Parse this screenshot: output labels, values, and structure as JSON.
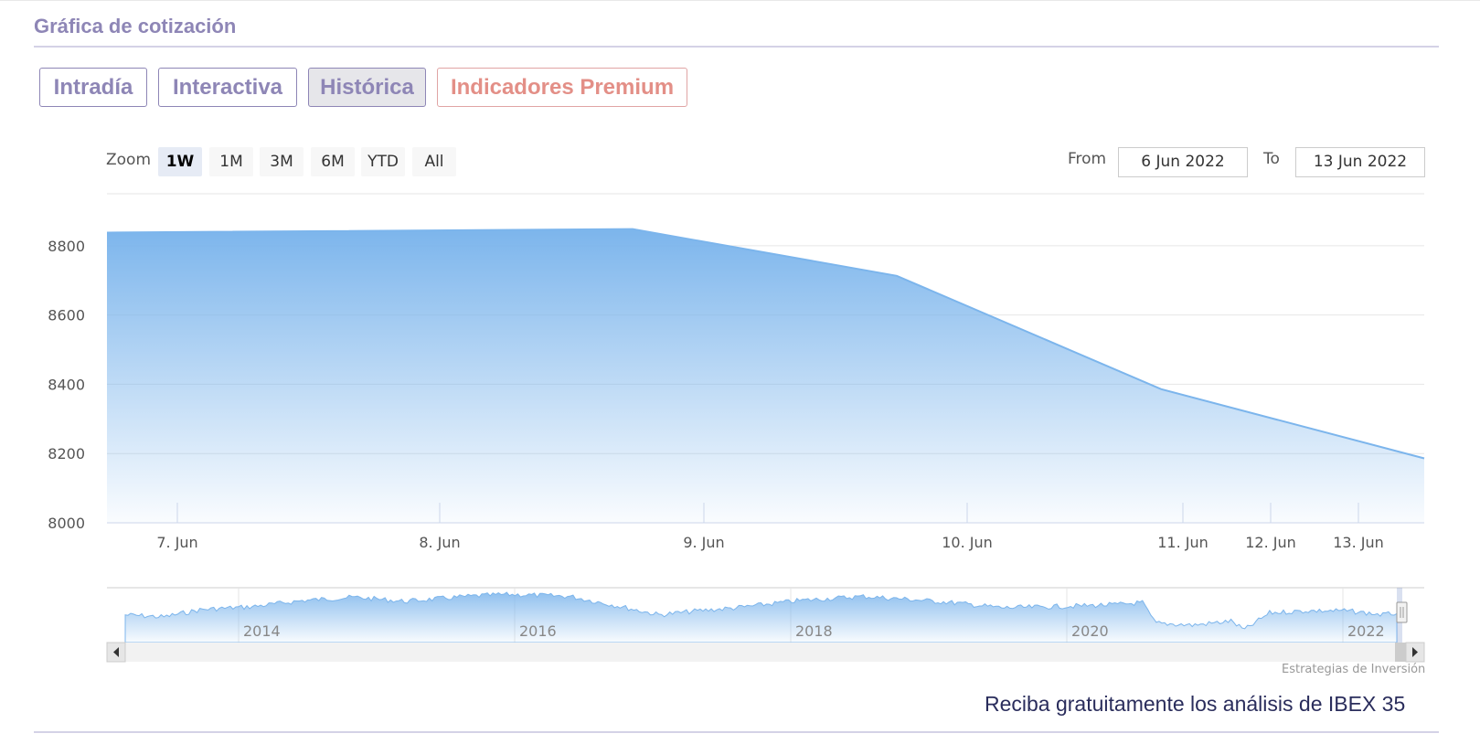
{
  "header": {
    "title": "Gráfica de cotización"
  },
  "tabs": [
    {
      "label": "Intradía"
    },
    {
      "label": "Interactiva"
    },
    {
      "label": "Histórica"
    },
    {
      "label": "Indicadores Premium"
    }
  ],
  "active_tab": "Histórica",
  "range_selector": {
    "zoom_label": "Zoom",
    "buttons": [
      "1W",
      "1M",
      "3M",
      "6M",
      "YTD",
      "All"
    ],
    "active": "1W",
    "from_label": "From",
    "from_value": "6 Jun 2022",
    "to_label": "To",
    "to_value": "13 Jun 2022"
  },
  "chart_data": {
    "type": "area",
    "x": [
      "2022-06-06",
      "2022-06-08",
      "2022-06-09",
      "2022-06-10",
      "2022-06-13"
    ],
    "values": [
      8838,
      8848,
      8713,
      8386,
      8186
    ],
    "x_tick_labels": [
      "7. Jun",
      "8. Jun",
      "9. Jun",
      "10. Jun",
      "11. Jun",
      "12. Jun",
      "13. Jun"
    ],
    "y_ticks": [
      8000,
      8200,
      8400,
      8600,
      8800
    ],
    "ylim": [
      8000,
      8950
    ],
    "grid": true,
    "color": "#7cb5ec",
    "navigator": {
      "year_labels": [
        "2014",
        "2016",
        "2018",
        "2020",
        "2022"
      ]
    }
  },
  "credit": "Estrategias de Inversión",
  "cta": "Reciba gratuitamente los análisis de IBEX 35"
}
